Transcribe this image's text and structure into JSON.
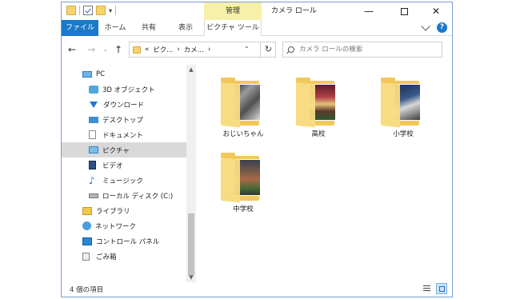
{
  "window": {
    "title": "カメラ ロール",
    "manage_tab": "管理",
    "qat_dropdown": "▾",
    "minimize": "—",
    "close": "✕"
  },
  "ribbon": {
    "tabs": [
      "ファイル",
      "ホーム",
      "共有",
      "表示",
      "ピクチャ ツール"
    ],
    "help": "?"
  },
  "address": {
    "path": [
      "«",
      "ピク...",
      "›",
      "カメ...",
      "›"
    ],
    "dropdown": "⌄",
    "refresh": "↻",
    "back": "←",
    "forward": "→",
    "up": "↑",
    "recent": "⌄"
  },
  "search": {
    "placeholder": "カメラ ロールの検索"
  },
  "navpane": {
    "items": [
      {
        "label": "PC",
        "icon": "pc-icon"
      },
      {
        "label": "3D オブジェクト",
        "icon": "3d-objects-icon"
      },
      {
        "label": "ダウンロード",
        "icon": "download-icon"
      },
      {
        "label": "デスクトップ",
        "icon": "desktop-icon"
      },
      {
        "label": "ドキュメント",
        "icon": "documents-icon"
      },
      {
        "label": "ピクチャ",
        "icon": "pictures-icon",
        "selected": true
      },
      {
        "label": "ビデオ",
        "icon": "videos-icon"
      },
      {
        "label": "ミュージック",
        "icon": "music-icon"
      },
      {
        "label": "ローカル ディスク (C:)",
        "icon": "local-disk-icon"
      },
      {
        "label": "ライブラリ",
        "icon": "library-icon"
      },
      {
        "label": "ネットワーク",
        "icon": "network-icon"
      },
      {
        "label": "コントロール パネル",
        "icon": "control-panel-icon"
      },
      {
        "label": "ごみ箱",
        "icon": "recycle-bin-icon"
      }
    ]
  },
  "scrollbar": {
    "up": "▲",
    "down": "▼"
  },
  "folders": [
    {
      "name": "おじいちゃん"
    },
    {
      "name": "高校"
    },
    {
      "name": "小学校"
    },
    {
      "name": "中学校"
    }
  ],
  "status": {
    "count_text": "4 個の項目"
  }
}
